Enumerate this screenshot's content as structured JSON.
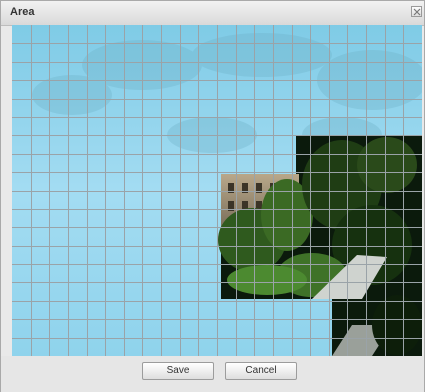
{
  "dialog": {
    "title": "Area",
    "close_icon": "close-icon"
  },
  "area_grid": {
    "columns": 22,
    "rows": 18,
    "grid_color": "#9aa3a8",
    "region_color": "#9ad7ef"
  },
  "buttons": {
    "save_label": "Save",
    "cancel_label": "Cancel"
  }
}
